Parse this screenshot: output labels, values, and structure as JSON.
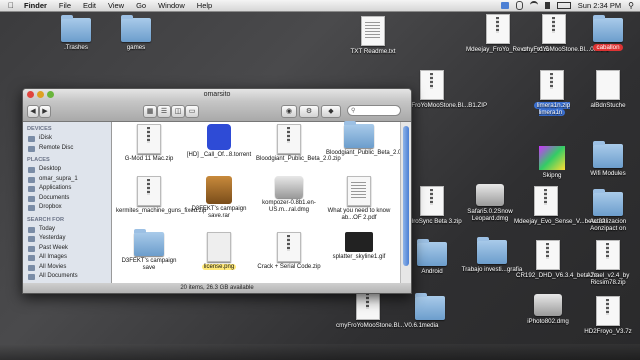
{
  "menubar": {
    "app": "Finder",
    "items": [
      "File",
      "Edit",
      "View",
      "Go",
      "Window",
      "Help"
    ],
    "clock": "Sun 2:34 PM"
  },
  "desktop_icons": [
    {
      "name": ".Trashes",
      "kind": "folder"
    },
    {
      "name": "games",
      "kind": "folder"
    },
    {
      "name": "TXT Readme.txt",
      "kind": "txt"
    },
    {
      "name": "Mdeejay_FroYo_Revol..._v1.5",
      "kind": "zip"
    },
    {
      "name": "cmyFroYoMooStone.Bl...0.6.2.1",
      "kind": "zip"
    },
    {
      "name": "caballon",
      "kind": "folder"
    },
    {
      "name": "cmyFroYoMooStone.Bl...B1.ZIP",
      "kind": "zip"
    },
    {
      "name": "limera1n.zip limera1n",
      "kind": "zip"
    },
    {
      "name": "alBdnStuche",
      "kind": "doc"
    },
    {
      "name": "Skipng",
      "kind": "img"
    },
    {
      "name": "Wifi Modules",
      "kind": "folder"
    },
    {
      "name": "AndroSync Beta 3.zip",
      "kind": "zip"
    },
    {
      "name": "Safari5.0.2Snow Leopard.dmg",
      "kind": "dmg"
    },
    {
      "name": "Mdeejay_Evo_Sense_V...beta.22",
      "kind": "zip"
    },
    {
      "name": "Actualizacion Aonzipact on",
      "kind": "folder"
    },
    {
      "name": "Android",
      "kind": "folder"
    },
    {
      "name": "Trabajo investi...grafia",
      "kind": "folder"
    },
    {
      "name": "CR192_DHD_V6.3.4_beta.7z",
      "kind": "zip"
    },
    {
      "name": "Azrael_v2.4_by Ricsim78.zip",
      "kind": "zip"
    },
    {
      "name": "cmyFroYoMooStone.Bl...V0.6.1",
      "kind": "zip"
    },
    {
      "name": "media",
      "kind": "folder"
    },
    {
      "name": "iPhoto802.dmg",
      "kind": "dmg"
    },
    {
      "name": "HD2Froyo_V3.7z",
      "kind": "zip"
    }
  ],
  "finder": {
    "title": "omarsito",
    "search_placeholder": "",
    "status": "20 items, 26.3 GB available",
    "sidebar": {
      "devices_head": "DEVICES",
      "devices": [
        "iDisk",
        "Remote Disc"
      ],
      "places_head": "PLACES",
      "places": [
        "Desktop",
        "omar_supra_1",
        "Applications",
        "Documents",
        "Dropbox"
      ],
      "search_head": "SEARCH FOR",
      "search": [
        "Today",
        "Yesterday",
        "Past Week",
        "All Images",
        "All Movies",
        "All Documents"
      ]
    },
    "files": [
      {
        "name": "G-Mod 11 Mac.zip",
        "kind": "zip"
      },
      {
        "name": "[HD] _Call_Of...8.torrent",
        "kind": "torrent"
      },
      {
        "name": "Bloodgiant_Public_Beta_2.0.zip",
        "kind": "zip"
      },
      {
        "name": "Bloodgiant_Public_Beta_2.0",
        "kind": "folder"
      },
      {
        "name": "kermites_machine_guns_fixed.zip",
        "kind": "zip"
      },
      {
        "name": "D3FEKT's campaign save.rar",
        "kind": "rar"
      },
      {
        "name": "kompozer-0.8b1.en-US.m...ral.dmg",
        "kind": "dmg"
      },
      {
        "name": "What you need to know ab...OF 2.pdf",
        "kind": "pdf"
      },
      {
        "name": "D3FEKT's campaign save",
        "kind": "folder"
      },
      {
        "name": "license.png",
        "kind": "png"
      },
      {
        "name": "Crack + Serial Code.zip",
        "kind": "zip"
      },
      {
        "name": "splatter_skyline1.gif",
        "kind": "gif"
      }
    ]
  },
  "colors": {
    "accent": "#3a6fd0",
    "highlight": "#ffe97a",
    "label_red": "#d33333"
  }
}
